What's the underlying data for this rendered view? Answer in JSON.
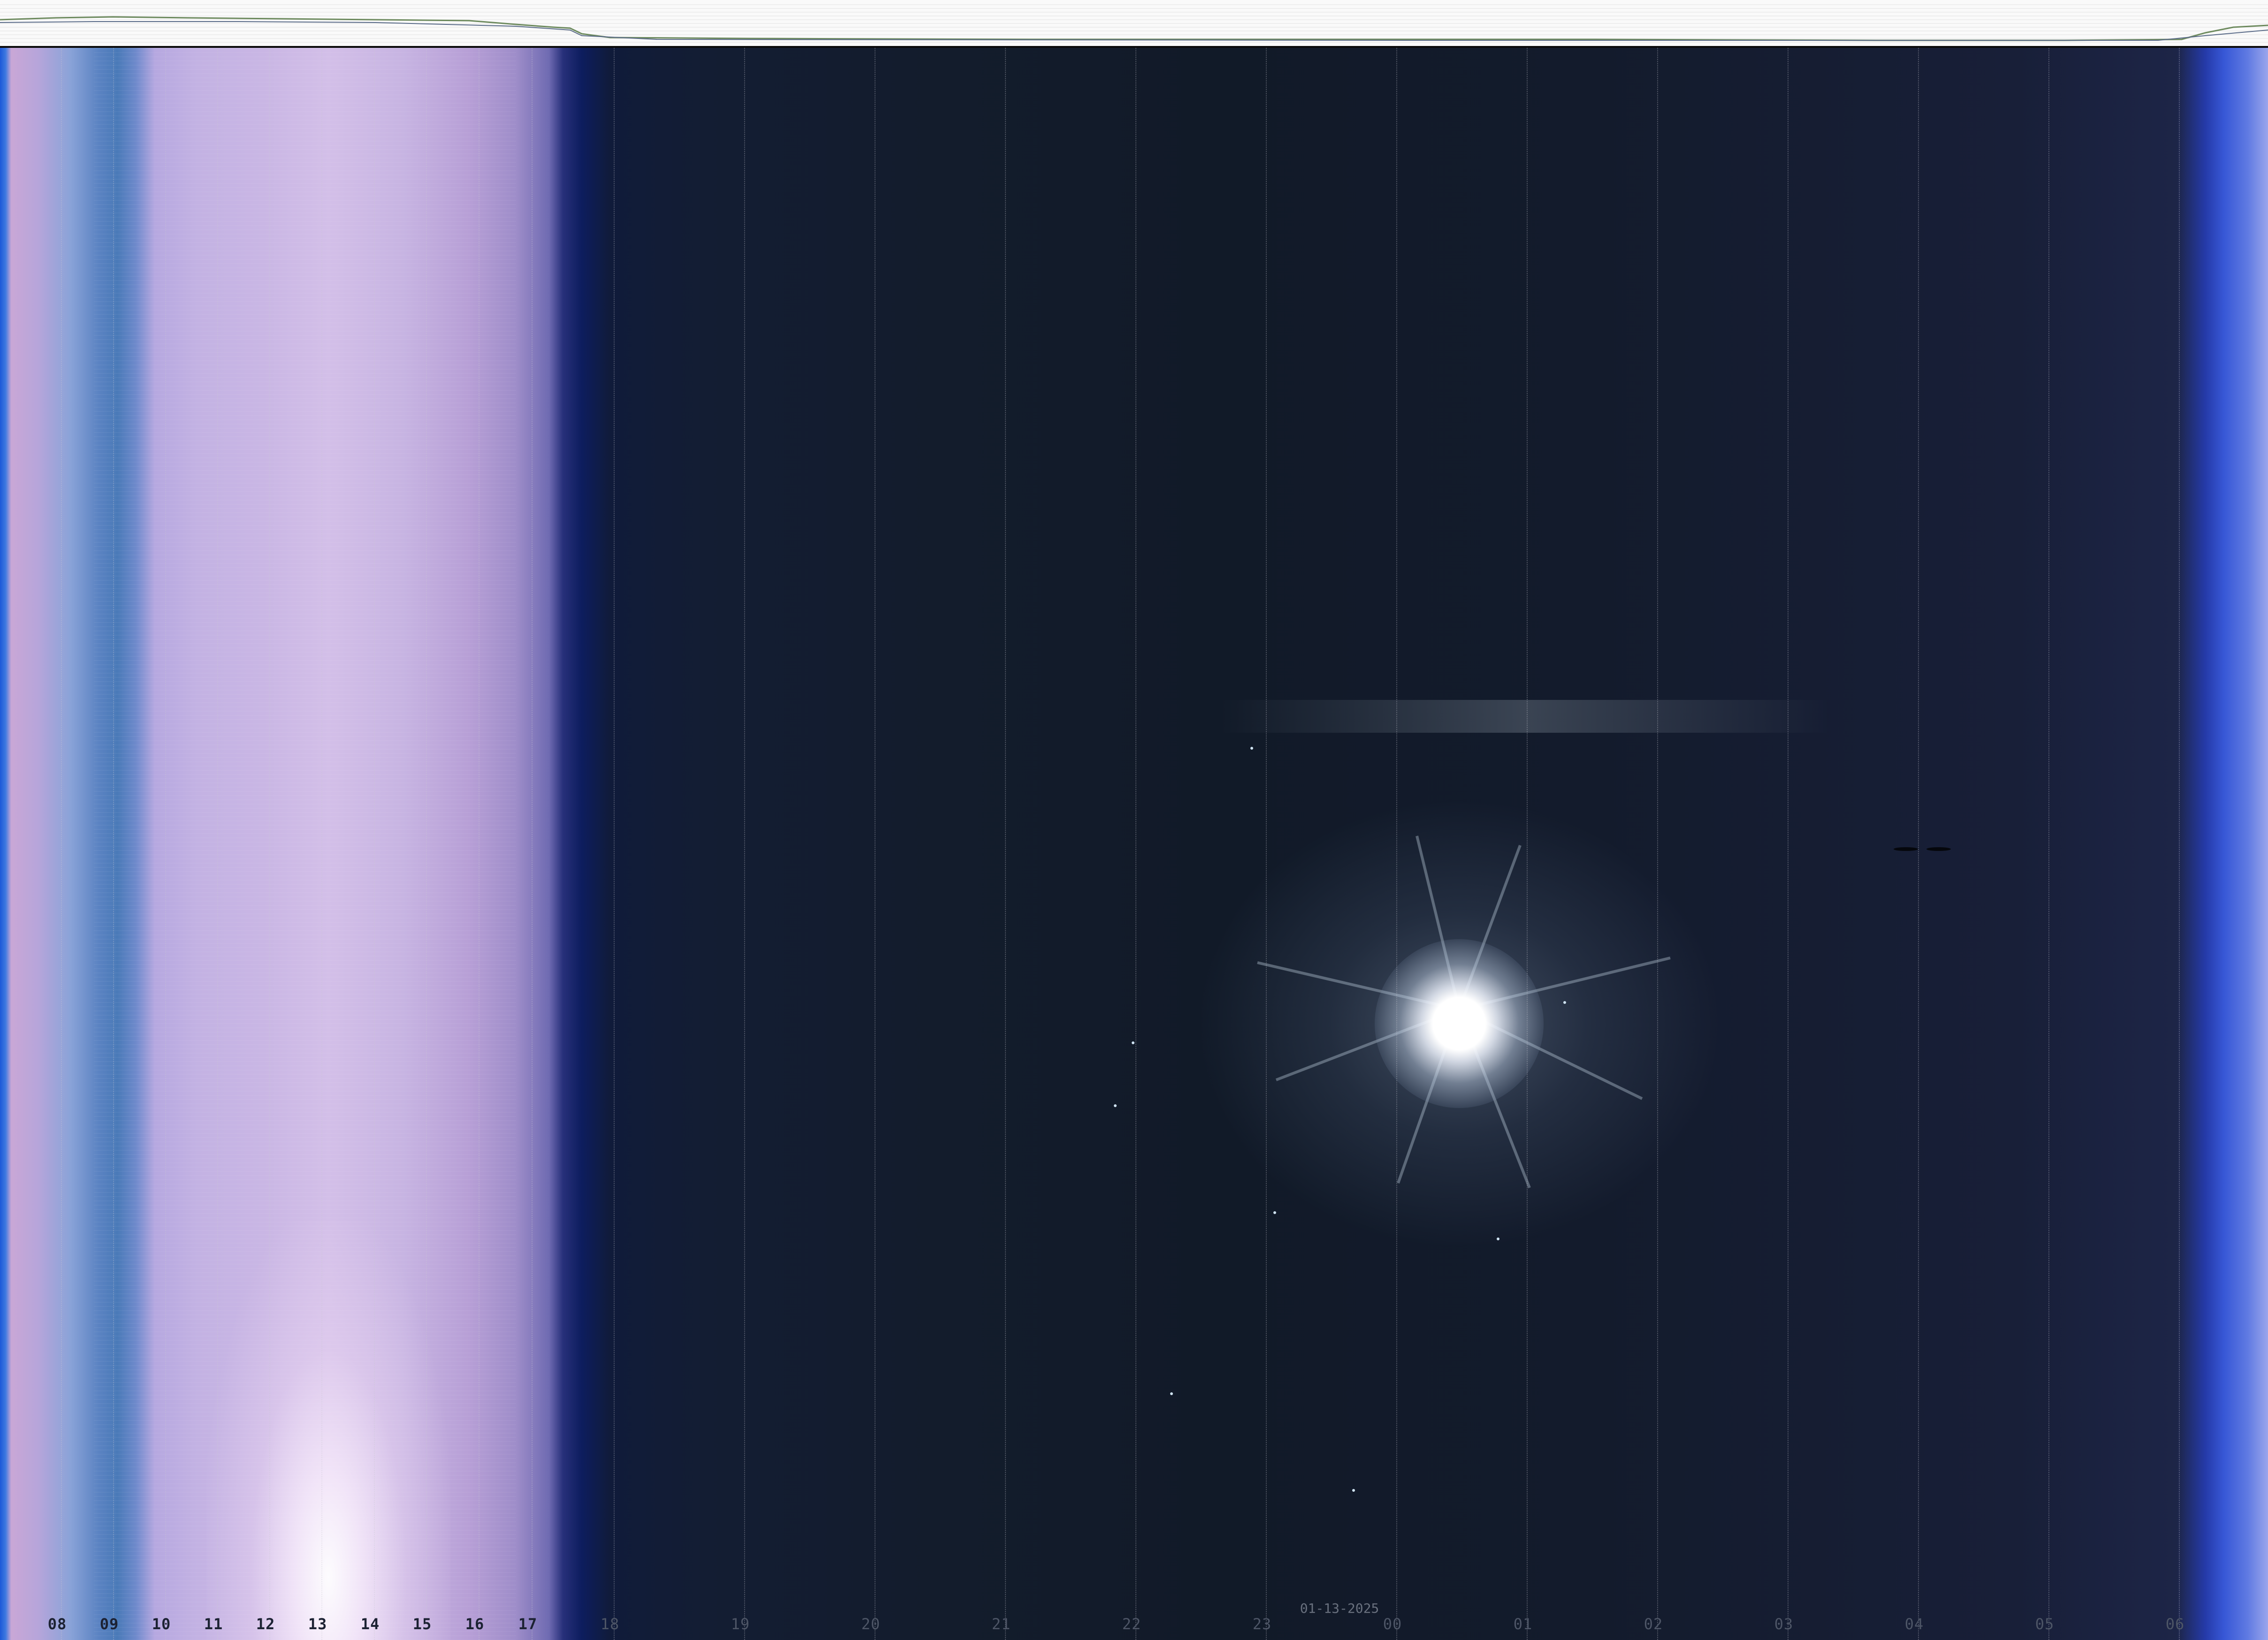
{
  "image": {
    "kind": "all-sky keogram",
    "date_label": "01-13-2025",
    "hour_labels": [
      {
        "text": "08",
        "period": "day"
      },
      {
        "text": "09",
        "period": "day"
      },
      {
        "text": "10",
        "period": "day"
      },
      {
        "text": "11",
        "period": "day"
      },
      {
        "text": "12",
        "period": "day"
      },
      {
        "text": "13",
        "period": "day"
      },
      {
        "text": "14",
        "period": "day"
      },
      {
        "text": "15",
        "period": "day"
      },
      {
        "text": "16",
        "period": "day"
      },
      {
        "text": "17",
        "period": "day"
      },
      {
        "text": "18",
        "period": "night"
      },
      {
        "text": "19",
        "period": "night"
      },
      {
        "text": "20",
        "period": "night"
      },
      {
        "text": "21",
        "period": "night"
      },
      {
        "text": "22",
        "period": "night"
      },
      {
        "text": "23",
        "period": "night"
      },
      {
        "text": "00",
        "period": "night"
      },
      {
        "text": "01",
        "period": "night"
      },
      {
        "text": "02",
        "period": "night"
      },
      {
        "text": "03",
        "period": "night"
      },
      {
        "text": "04",
        "period": "night"
      },
      {
        "text": "05",
        "period": "night"
      },
      {
        "text": "06",
        "period": "night"
      }
    ],
    "colors": {
      "day_sky": "#c9b6e4",
      "night_sky": "#131c2c",
      "twilight_edge": "#3757d6",
      "moon": "#ffffff"
    }
  }
}
